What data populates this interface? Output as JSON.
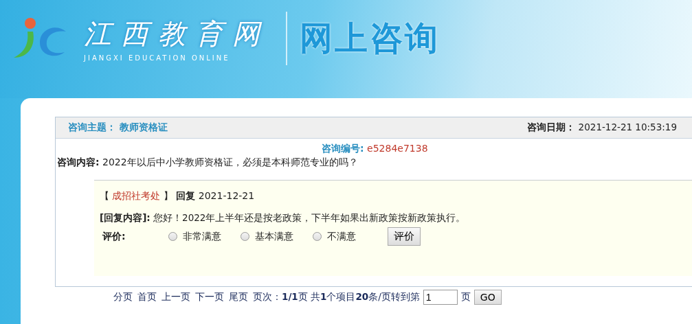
{
  "header": {
    "logo_title": "江西教育网",
    "logo_subtitle": "JIANGXI EDUCATION ONLINE",
    "page_title": "网上咨询"
  },
  "consultation": {
    "topic_label": "咨询主题：",
    "topic": "教师资格证",
    "date_label": "咨询日期：",
    "date": "2021-12-21 10:53:19",
    "number_label": "咨询编号:",
    "number": "e5284e7138",
    "content_label": "咨询内容:",
    "content": "2022年以后中小学教师资格证，必须是本科师范专业的吗？"
  },
  "reply": {
    "bracket_open": "【",
    "department": "成招社考处",
    "bracket_close": "】",
    "reply_label": "回复",
    "reply_date": "2021-12-21",
    "content_label": "[回复内容]:",
    "content": "您好！2022年上半年还是按老政策，下半年如果出新政策按新政策执行。",
    "rating_label": "评价:",
    "options": [
      {
        "label": "非常满意",
        "selected": false
      },
      {
        "label": "基本满意",
        "selected": false
      },
      {
        "label": "不满意",
        "selected": false
      }
    ],
    "rate_button": "评价"
  },
  "pager": {
    "links": [
      "分页",
      "首页",
      "上一页",
      "下一页",
      "尾页"
    ],
    "info": "页次：**1/1**页 共**1**个项目**20**条/页转到第",
    "page_input": "1",
    "page_suffix": "页",
    "go_button": "GO"
  }
}
